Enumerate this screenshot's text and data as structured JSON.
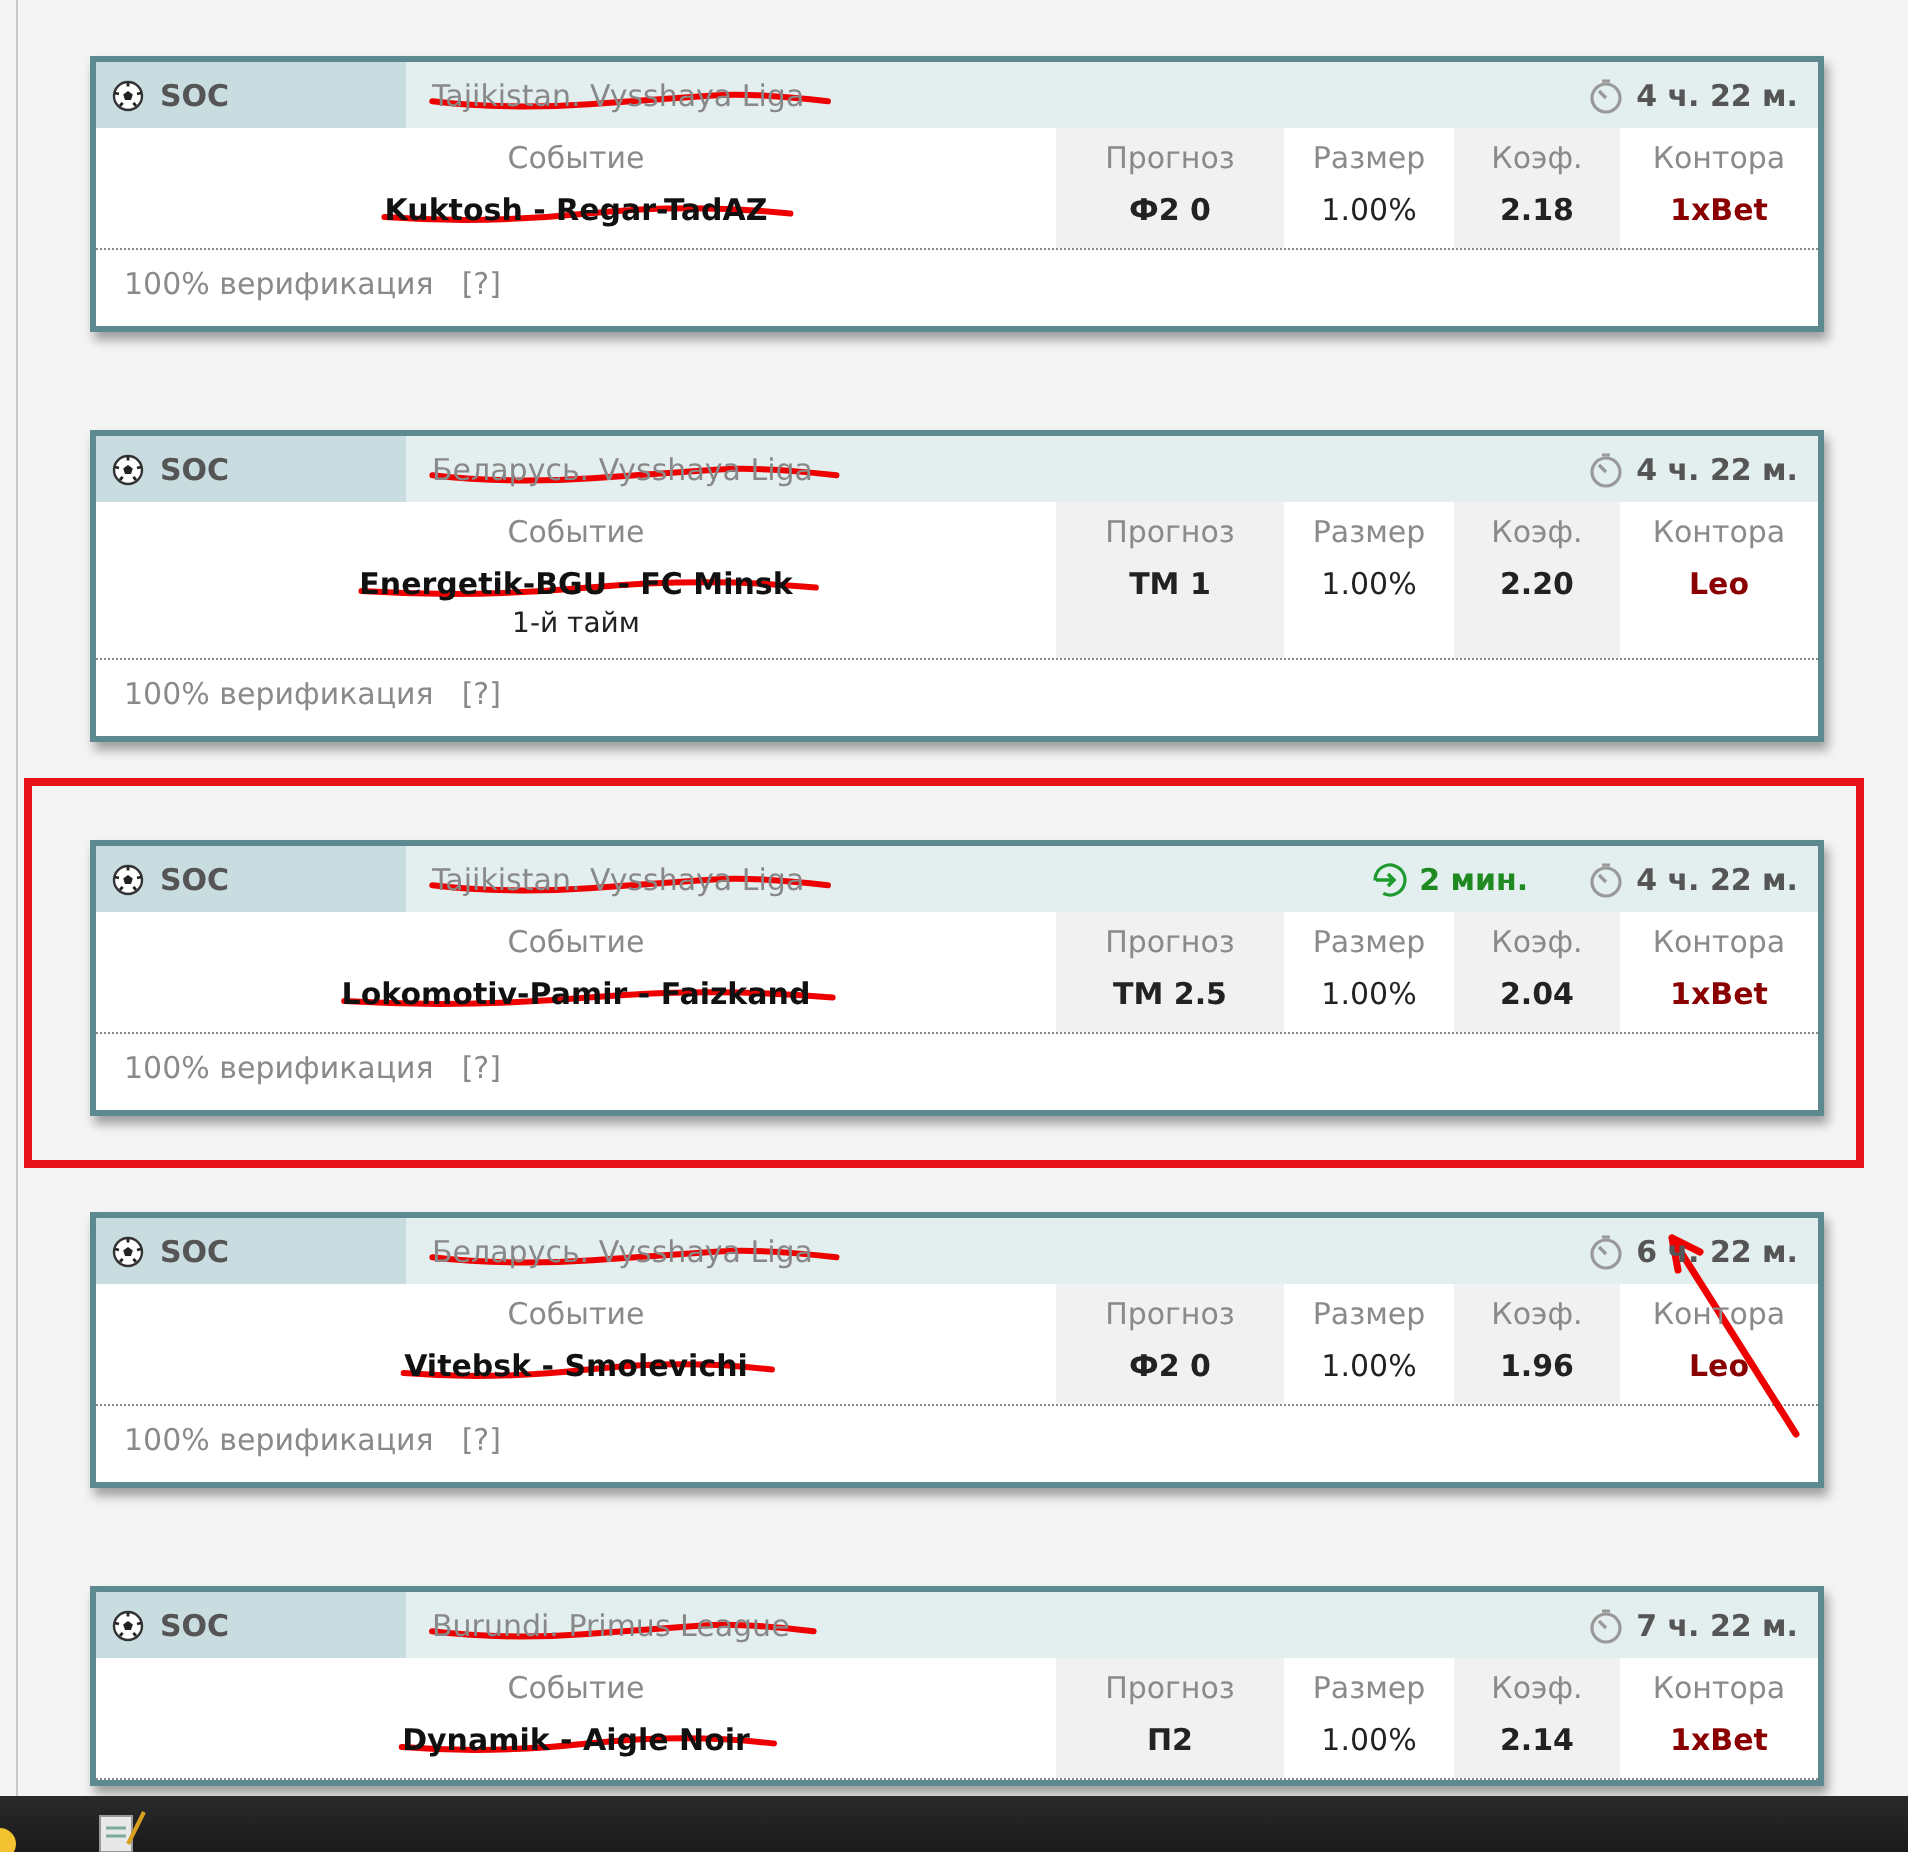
{
  "cards": [
    {
      "sport": "SOC",
      "league": "Tajikistan. Vysshaya Liga",
      "league_struck": true,
      "time": "4 ч. 22 м.",
      "event_label": "Событие",
      "headers": [
        "Прогноз",
        "Размер",
        "Коэф.",
        "Контора"
      ],
      "event": "Kuktosh - Regar-TadAZ",
      "event_struck": true,
      "forecast": "Ф2 0",
      "stake": "1.00%",
      "odds": "2.18",
      "bookmaker": "1xBet",
      "verification": "100% верификация",
      "help": "[?]",
      "highlighted": false,
      "pointed": false
    },
    {
      "sport": "SOC",
      "league": "Беларусь. Vysshaya Liga",
      "league_struck": true,
      "time": "4 ч. 22 м.",
      "event_label": "Событие",
      "headers": [
        "Прогноз",
        "Размер",
        "Коэф.",
        "Контора"
      ],
      "event": "Energetik-BGU - FC Minsk",
      "event_struck": true,
      "note": "1-й тайм",
      "forecast": "ТМ 1",
      "stake": "1.00%",
      "odds": "2.20",
      "bookmaker": "Leo",
      "verification": "100% верификация",
      "help": "[?]",
      "highlighted": false,
      "pointed": false
    },
    {
      "sport": "SOC",
      "league": "Tajikistan. Vysshaya Liga",
      "league_struck": true,
      "live": "2 мин.",
      "time": "4 ч. 22 м.",
      "event_label": "Событие",
      "headers": [
        "Прогноз",
        "Размер",
        "Коэф.",
        "Контора"
      ],
      "event": "Lokomotiv-Pamir - Faizkand",
      "event_struck": true,
      "forecast": "ТМ 2.5",
      "stake": "1.00%",
      "odds": "2.04",
      "bookmaker": "1xBet",
      "verification": "100% верификация",
      "help": "[?]",
      "highlighted": true,
      "pointed": false
    },
    {
      "sport": "SOC",
      "league": "Беларусь. Vysshaya Liga",
      "league_struck": true,
      "time": "6 ч. 22 м.",
      "event_label": "Событие",
      "headers": [
        "Прогноз",
        "Размер",
        "Коэф.",
        "Контора"
      ],
      "event": "Vitebsk - Smolevichi",
      "event_struck": true,
      "forecast": "Ф2 0",
      "stake": "1.00%",
      "odds": "1.96",
      "bookmaker": "Leo",
      "verification": "100% верификация",
      "help": "[?]",
      "highlighted": false,
      "pointed": true
    },
    {
      "sport": "SOC",
      "league": "Burundi. Primus League",
      "league_struck": true,
      "time": "7 ч. 22 м.",
      "event_label": "Событие",
      "headers": [
        "Прогноз",
        "Размер",
        "Коэф.",
        "Контора"
      ],
      "event": "Dynamik - Aigle Noir",
      "event_struck": true,
      "forecast": "П2",
      "stake": "1.00%",
      "odds": "2.14",
      "bookmaker": "1xBet",
      "highlighted": false,
      "pointed": false
    }
  ]
}
